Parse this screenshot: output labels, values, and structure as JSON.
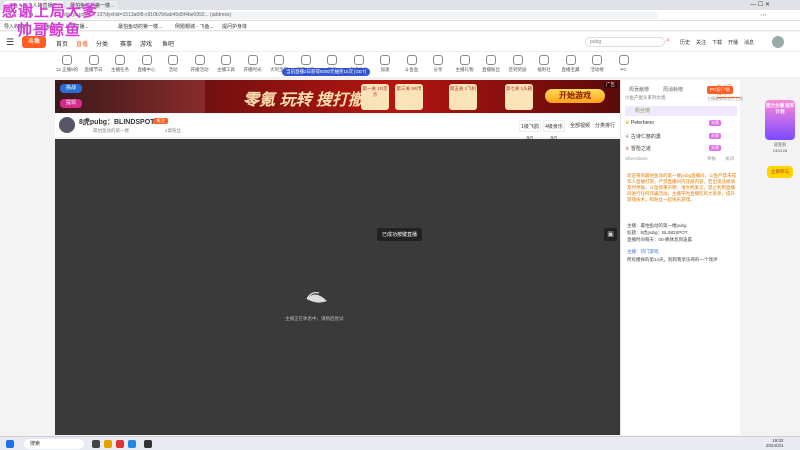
{
  "browser": {
    "tabs": [
      "斗鱼 - 每个人的直播平台",
      "最怕鱼动的第一楼...",
      "例子 - 鱼鱼鱼",
      "提问护身体"
    ],
    "url": "douyu.com/ ... 13?dyshid=1513a6f8-c910b7b6ab45d9f4be0992... (address)",
    "bookmarks": [
      "导入收藏夹",
      "斗鱼 - 每个人的直播...",
      "最怕鱼动的第一楼...",
      "例题帽城 - 飞鱼...",
      "提问护身体"
    ]
  },
  "overlay": {
    "line1": "感谢上局大爹",
    "line2": "帅哥鲸鱼"
  },
  "nav": {
    "logo": "斗鱼",
    "items": [
      "首页",
      "直播",
      "分类",
      "赛事",
      "游戏",
      "鱼吧"
    ],
    "search_placeholder": "pubg",
    "right_items": [
      "历史",
      "关注",
      "下载",
      "开播",
      "消息"
    ]
  },
  "categories": [
    {
      "label": "12 正播9的"
    },
    {
      "label": "直播节日"
    },
    {
      "label": "主播任务"
    },
    {
      "label": "直播中心"
    },
    {
      "label": "活动"
    },
    {
      "label": "开播活动"
    },
    {
      "label": "主播工具"
    },
    {
      "label": "开播时光"
    },
    {
      "label": "大鸡宝藏"
    },
    {
      "label": "观看抽奖"
    },
    {
      "label": "签到"
    },
    {
      "label": "直播任务"
    },
    {
      "label": "加速"
    },
    {
      "label": "斗鱼鱼"
    },
    {
      "label": "分享"
    },
    {
      "label": "主播礼物"
    },
    {
      "label": "直播粉丝"
    },
    {
      "label": "签到奖励"
    },
    {
      "label": "福利社"
    },
    {
      "label": "直播宝藏"
    },
    {
      "label": "活动榜"
    },
    {
      "label": "PC"
    }
  ],
  "cat_tooltip": "当前直播2日获得5000元抽奖10次 [GET]",
  "banner": {
    "title": "零氪 玩转 搜打撤",
    "steps": [
      "第一关 1R货点",
      "第三关 5R币",
      "第五关 1飞机",
      "第七关 1头箱"
    ],
    "cta": "开始游戏",
    "badge": "广告"
  },
  "streamer": {
    "name": "8虎pubg：BLINDSPOT",
    "tag": "关注",
    "sub": "最怕鱼动的第一楼",
    "fans": "4萬粉丝",
    "stats": [
      "1级飞鸽 0/1",
      "4级亲乐 0/1",
      "全部视频",
      "分类排行"
    ]
  },
  "player": {
    "notice": "已成功按键直播",
    "loading": "主播正在休息中，请稍后尝试"
  },
  "side": {
    "tabs": [
      "周贡献榜",
      "周消耗榜",
      "粉丝团(14)"
    ],
    "pc_client": "PC客户端",
    "pc_sub": "主播最新动态已上线",
    "rank_title": "粉丝榜",
    "rank_subtitle": "小鱼产屋头系列大炮",
    "rankers": [
      {
        "name": "Peterbeno",
        "badge": "光荣"
      },
      {
        "name": "古诗仁慈的勇",
        "badge": "光荣"
      },
      {
        "name": "冒险之道",
        "badge": "光荣"
      }
    ],
    "viewer": "ShenGloen",
    "viewer_actions": [
      "举报",
      "关闭"
    ],
    "announce": "欢迎来到最怕鱼动的第一楼pubg直播间，斗鱼严禁未成年人直播打赏，严禁直播间内违规内容，若出现违规请及时举报。斗鱼郑重声明：请文明发言，禁止利用直播间进行任何诈骗活动。主播平时直播吃鸡大逃杀，提升游戏技术，和粉丝一起快乐游戏。",
    "msgs": [
      "主播：最怕鱼动的第一楼pubg",
      "标题：8虎pubg：BLINDSPOT",
      "直播时间每天：00-晚休息到凌晨"
    ],
    "gift_user": "主播：热门游戏",
    "gift_msg": "所有模样的第14天，别和我享乐哥的一个戏评"
  },
  "side_ad": {
    "title": "团力主播 冠军计划",
    "sub": "双签到 130/128",
    "cta": "立即参与"
  },
  "taskbar": {
    "search": "搜索",
    "time": "19:02",
    "date": "2024/3/1"
  }
}
